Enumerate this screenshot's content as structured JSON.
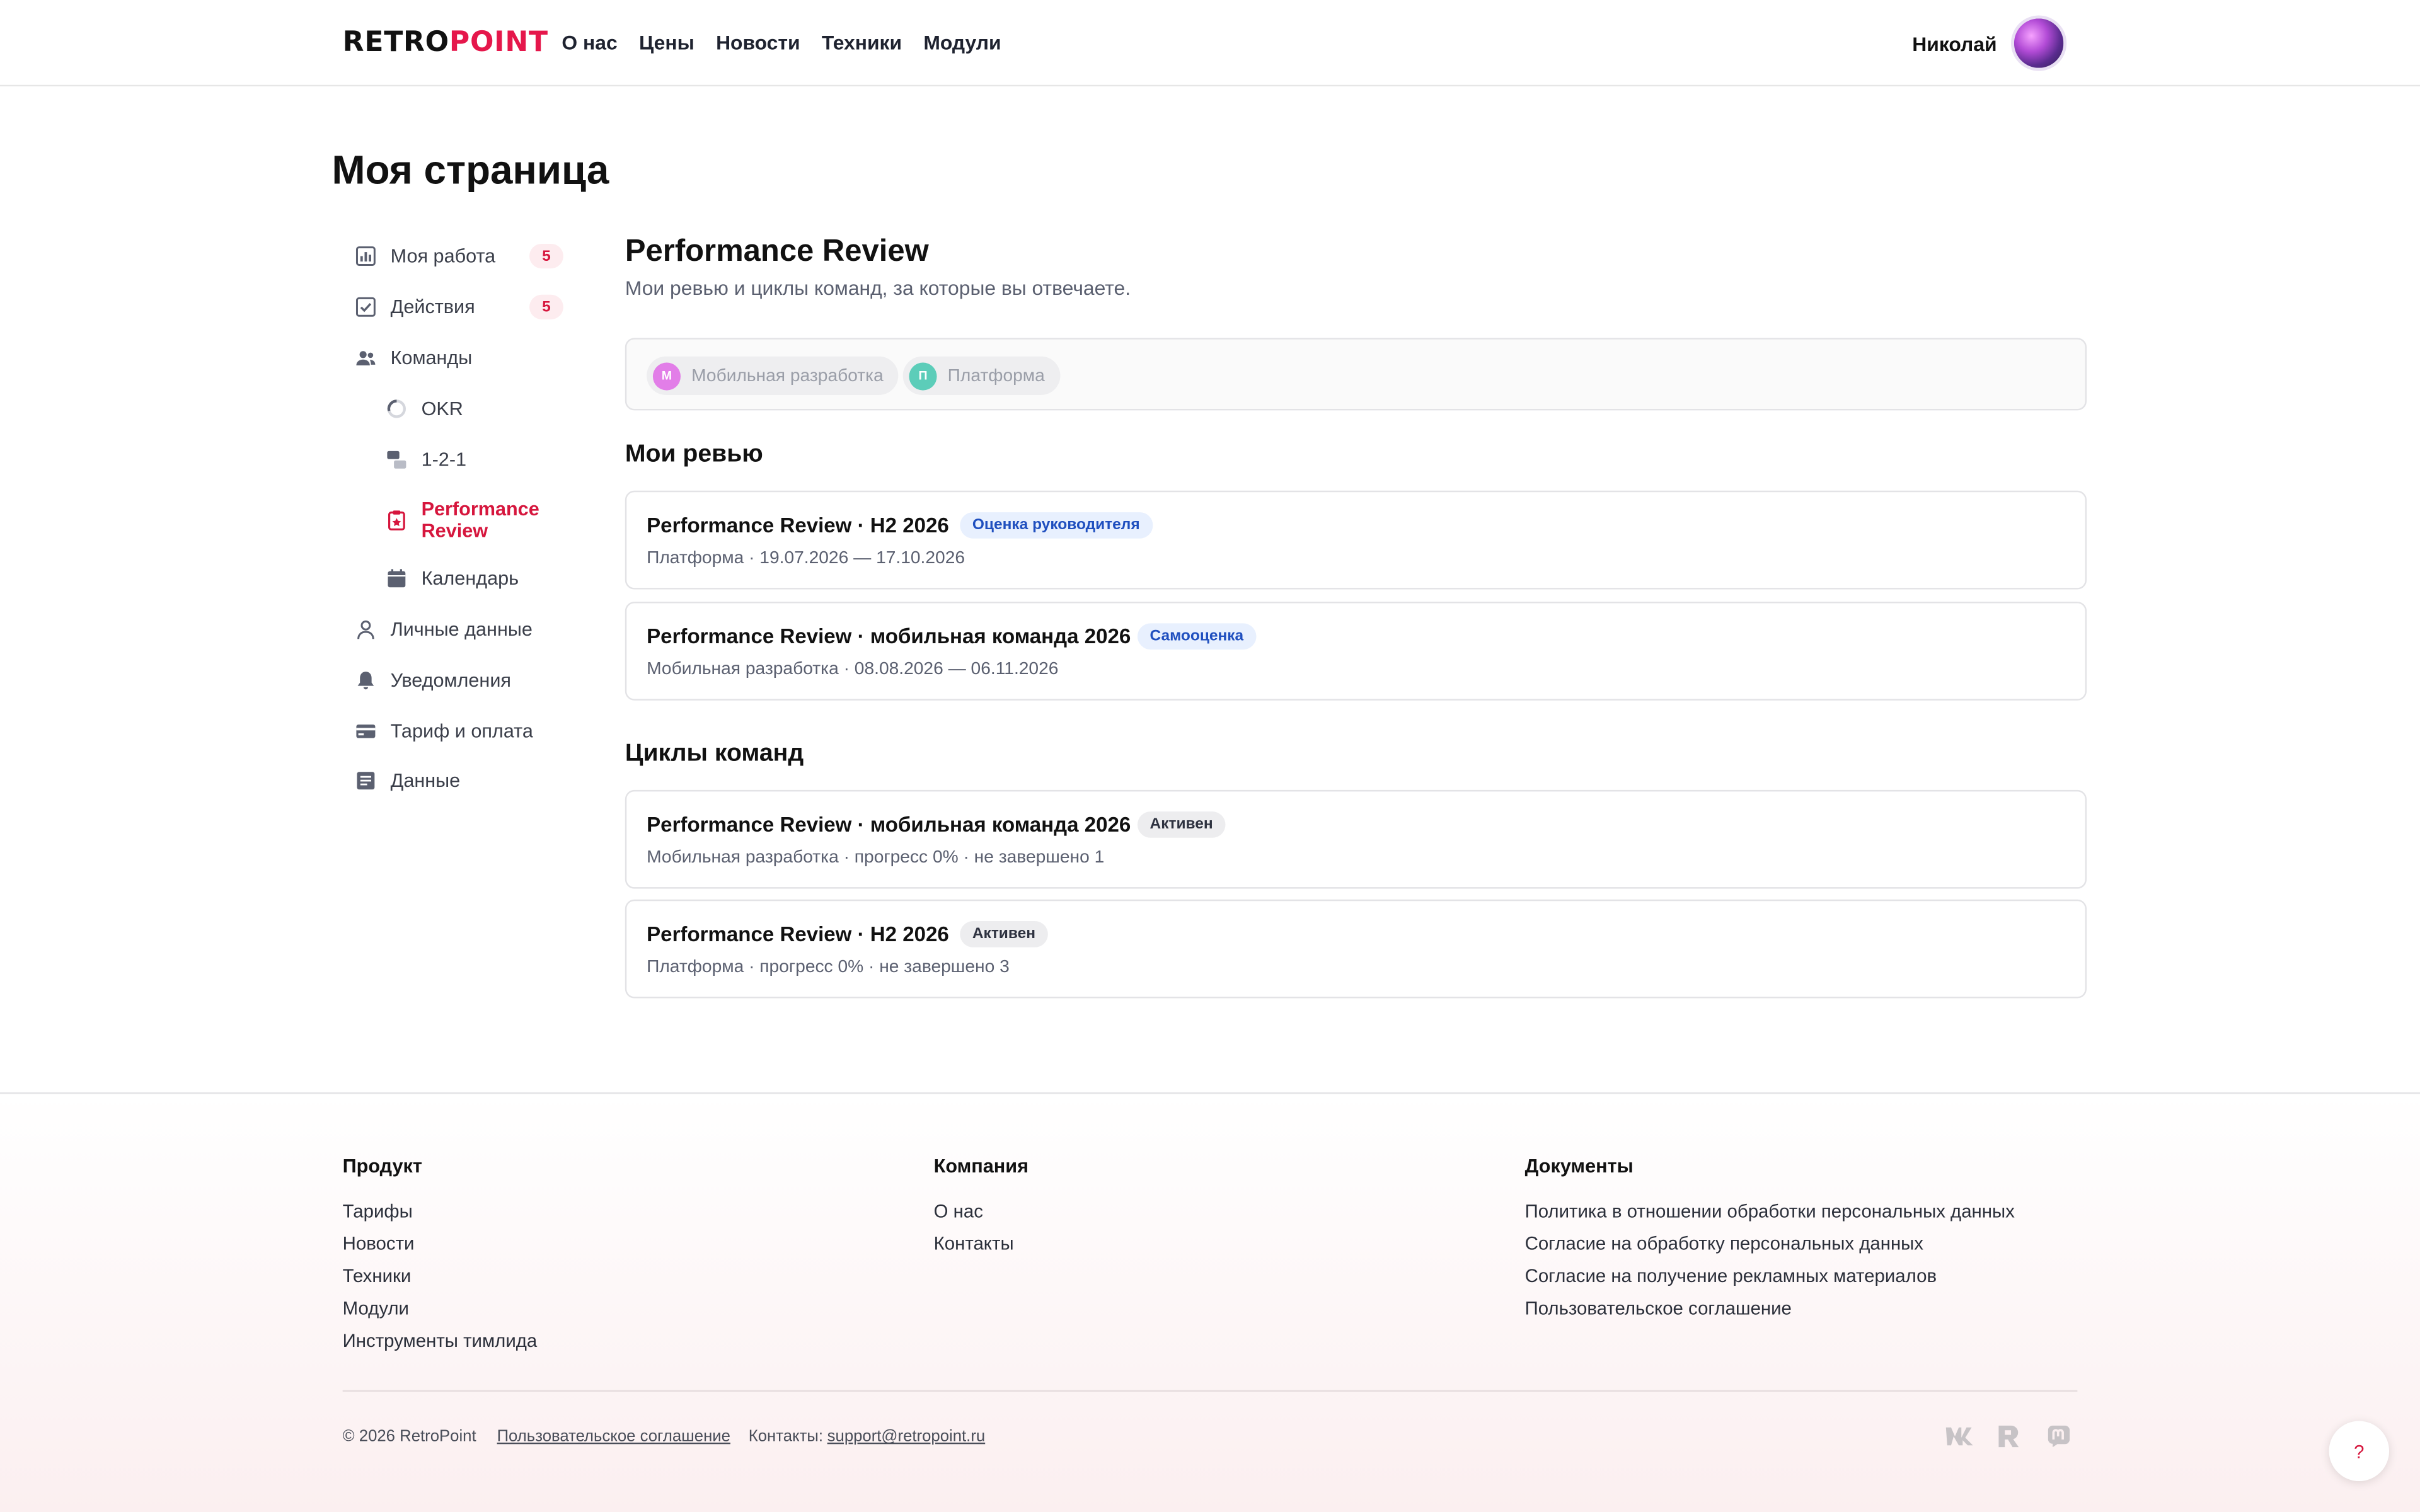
{
  "header": {
    "logo_part1": "RETRO",
    "logo_part2": "POINT",
    "nav": [
      "О нас",
      "Цены",
      "Новости",
      "Техники",
      "Модули"
    ],
    "user_name": "Николай"
  },
  "page_title": "Моя страница",
  "sidebar": {
    "items": [
      {
        "label": "Моя работа",
        "icon": "bar-chart-icon",
        "badge": "5"
      },
      {
        "label": "Действия",
        "icon": "checkbox-icon",
        "badge": "5"
      },
      {
        "label": "Команды",
        "icon": "users-icon"
      },
      {
        "label": "OKR",
        "icon": "progress-ring-icon"
      },
      {
        "label": "1-2-1",
        "icon": "chat-icon"
      },
      {
        "label": "Performance Review",
        "icon": "clipboard-star-icon",
        "active": true
      },
      {
        "label": "Календарь",
        "icon": "calendar-icon"
      },
      {
        "label": "Личные данные",
        "icon": "person-icon"
      },
      {
        "label": "Уведомления",
        "icon": "bell-icon"
      },
      {
        "label": "Тариф и оплата",
        "icon": "credit-card-icon"
      },
      {
        "label": "Данные",
        "icon": "document-icon"
      }
    ]
  },
  "main": {
    "title": "Performance Review",
    "subtitle": "Мои ревью и циклы команд, за которые вы отвечаете.",
    "teams": [
      {
        "initial": "М",
        "name": "Мобильная разработка",
        "color": "#e27ee8"
      },
      {
        "initial": "П",
        "name": "Платформа",
        "color": "#5ccdb9"
      }
    ],
    "my_reviews_title": "Мои ревью",
    "my_reviews": [
      {
        "title": "Performance Review · H2 2026",
        "tag": "Оценка руководителя",
        "meta": "Платформа · 19.07.2026 — 17.10.2026"
      },
      {
        "title": "Performance Review · мобильная команда 2026",
        "tag": "Самооценка",
        "meta": "Мобильная разработка · 08.08.2026 — 06.11.2026"
      }
    ],
    "cycles_title": "Циклы команд",
    "cycles": [
      {
        "title": "Performance Review · мобильная команда 2026",
        "tag": "Активен",
        "meta": "Мобильная разработка · прогресс 0% · не завершено 1"
      },
      {
        "title": "Performance Review · H2 2026",
        "tag": "Активен",
        "meta": "Платформа · прогресс 0% · не завершено 3"
      }
    ]
  },
  "footer": {
    "product_title": "Продукт",
    "product_links": [
      "Тарифы",
      "Новости",
      "Техники",
      "Модули",
      "Инструменты тимлида"
    ],
    "company_title": "Компания",
    "company_links": [
      "О нас",
      "Контакты"
    ],
    "docs_title": "Документы",
    "docs_links": [
      "Политика в отношении обработки персональных данных",
      "Согласие на обработку персональных данных",
      "Согласие на получение рекламных материалов",
      "Пользовательское соглашение"
    ],
    "copyright": "© 2026 RetroPoint",
    "agreement": "Пользовательское соглашение",
    "contacts_label": "Контакты:",
    "email": "support@retropoint.ru",
    "socials": [
      "vk-icon",
      "retropoint-icon",
      "mastodon-icon"
    ]
  },
  "help_label": "?"
}
